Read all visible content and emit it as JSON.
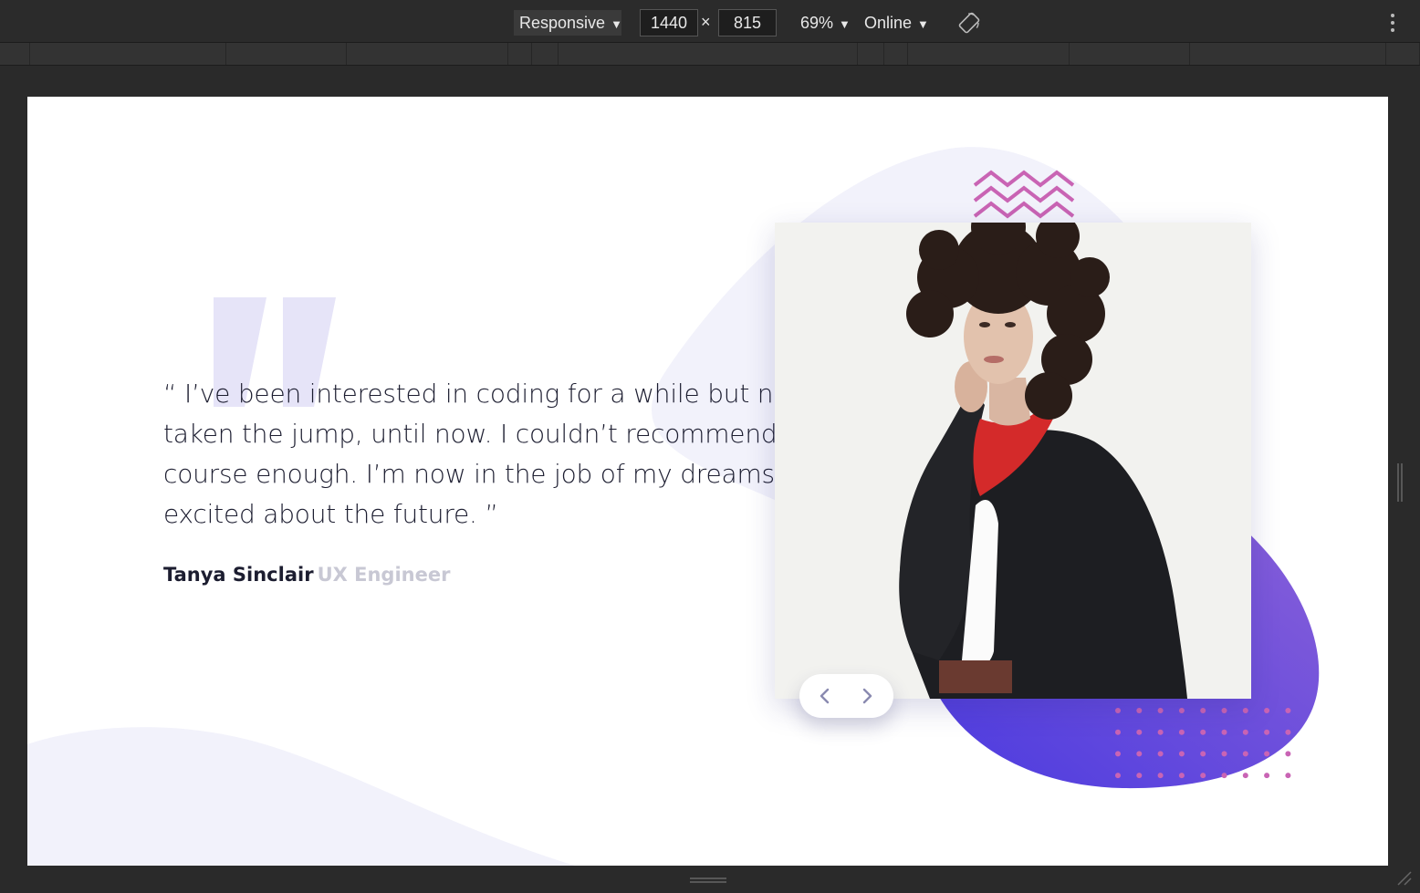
{
  "devtools": {
    "device": "Responsive",
    "width": "1440",
    "height": "815",
    "dim_separator": "×",
    "zoom": "69%",
    "throttle": "Online",
    "caret": "▼"
  },
  "testimonial": {
    "quote": "“ I’ve been interested in coding for a while but never taken the jump, until now. I couldn’t recommend this course enough. I’m now in the job of my dreams and so excited about the future. ”",
    "author_name": "Tanya Sinclair",
    "author_role": "UX Engineer"
  },
  "colors": {
    "blob_light": "#f2f2fb",
    "blob_gradient_start": "#4a3ae0",
    "blob_gradient_end": "#8c62d8",
    "accent_pink": "#c964b4",
    "quote_mark": "#e6e4f8",
    "text_dark": "#1c1d30",
    "text_muted": "#c8c8d4"
  },
  "icons": {
    "prev": "chevron-left-icon",
    "next": "chevron-right-icon",
    "rotate": "rotate-icon",
    "more": "more-vertical-icon"
  }
}
